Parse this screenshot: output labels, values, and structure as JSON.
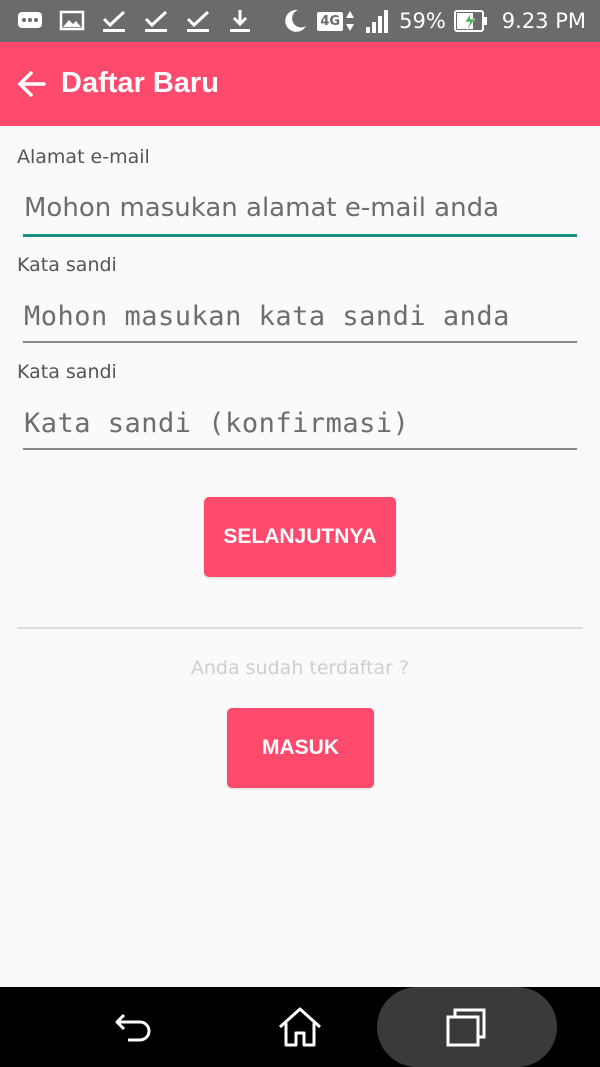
{
  "status_bar": {
    "battery_percent": "59%",
    "time": "9.23 PM",
    "network": "4G"
  },
  "app_bar": {
    "title": "Daftar Baru",
    "back_icon": "arrow-left-icon"
  },
  "form": {
    "email": {
      "label": "Alamat e-mail",
      "placeholder": "Mohon masukan alamat e-mail anda"
    },
    "password": {
      "label": "Kata sandi",
      "placeholder": "Mohon masukan kata sandi anda"
    },
    "password_confirm": {
      "label": "Kata sandi",
      "placeholder": "Kata sandi (konfirmasi)"
    },
    "next_button": "SELANJUTNYA"
  },
  "login": {
    "prompt": "Anda sudah terdaftar ?",
    "button": "MASUK"
  },
  "colors": {
    "accent": "#fe4a6d",
    "focus": "#1a9486",
    "status_bar": "#6b6b6b"
  }
}
